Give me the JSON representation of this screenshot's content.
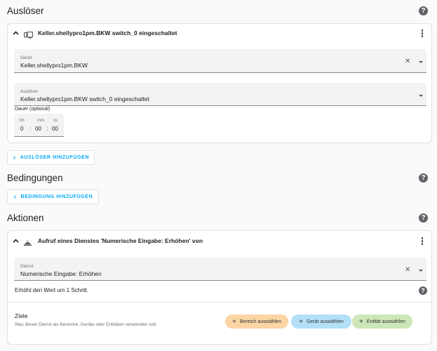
{
  "triggers": {
    "title": "Auslöser",
    "card": {
      "title": "Keller.shellypro1pm.BKW switch_0 eingeschaltet",
      "device_field": {
        "label": "Gerät",
        "value": "Keller.shellypro1pm.BKW"
      },
      "trigger_field": {
        "label": "Auslöser",
        "value": "Keller.shellypro1pm.BKW switch_0 eingeschaltet"
      },
      "duration": {
        "label": "Dauer (optional)",
        "hh_label": "hh",
        "mm_label": "mm",
        "ss_label": "ss",
        "hh": "0",
        "mm": "00",
        "ss": "00"
      }
    },
    "add_button": "AUSLÖSER HINZUFÜGEN"
  },
  "conditions": {
    "title": "Bedingungen",
    "add_button": "BEDINGUNG HINZUFÜGEN"
  },
  "actions": {
    "title": "Aktionen",
    "card": {
      "title": "Aufruf eines Dienstes 'Numerische Eingabe: Erhöhen' von",
      "service_field": {
        "label": "Dienst",
        "value": "Numerische Eingabe: Erhöhen"
      },
      "description": "Erhöht den Wert um 1 Schritt.",
      "targets": {
        "title": "Ziele",
        "subtitle": "Was dieser Dienst als Bereiche, Geräte oder Entitäten verwenden soll.",
        "area_button": "Bereich auswählen",
        "device_button": "Gerät auswählen",
        "entity_button": "Entität auswählen"
      }
    }
  },
  "colors": {
    "accent": "#03a9f4",
    "area_pill": "#fbd5a4",
    "device_pill": "#b3e0f7",
    "entity_pill": "#cde7b8"
  },
  "icons": {
    "help": "help-circle-icon",
    "collapse": "chevron-up-icon",
    "device": "device-icon",
    "service": "service-icon",
    "menu": "kebab-menu-icon",
    "clear": "close-icon",
    "dropdown": "caret-down-icon",
    "add": "plus-icon"
  }
}
